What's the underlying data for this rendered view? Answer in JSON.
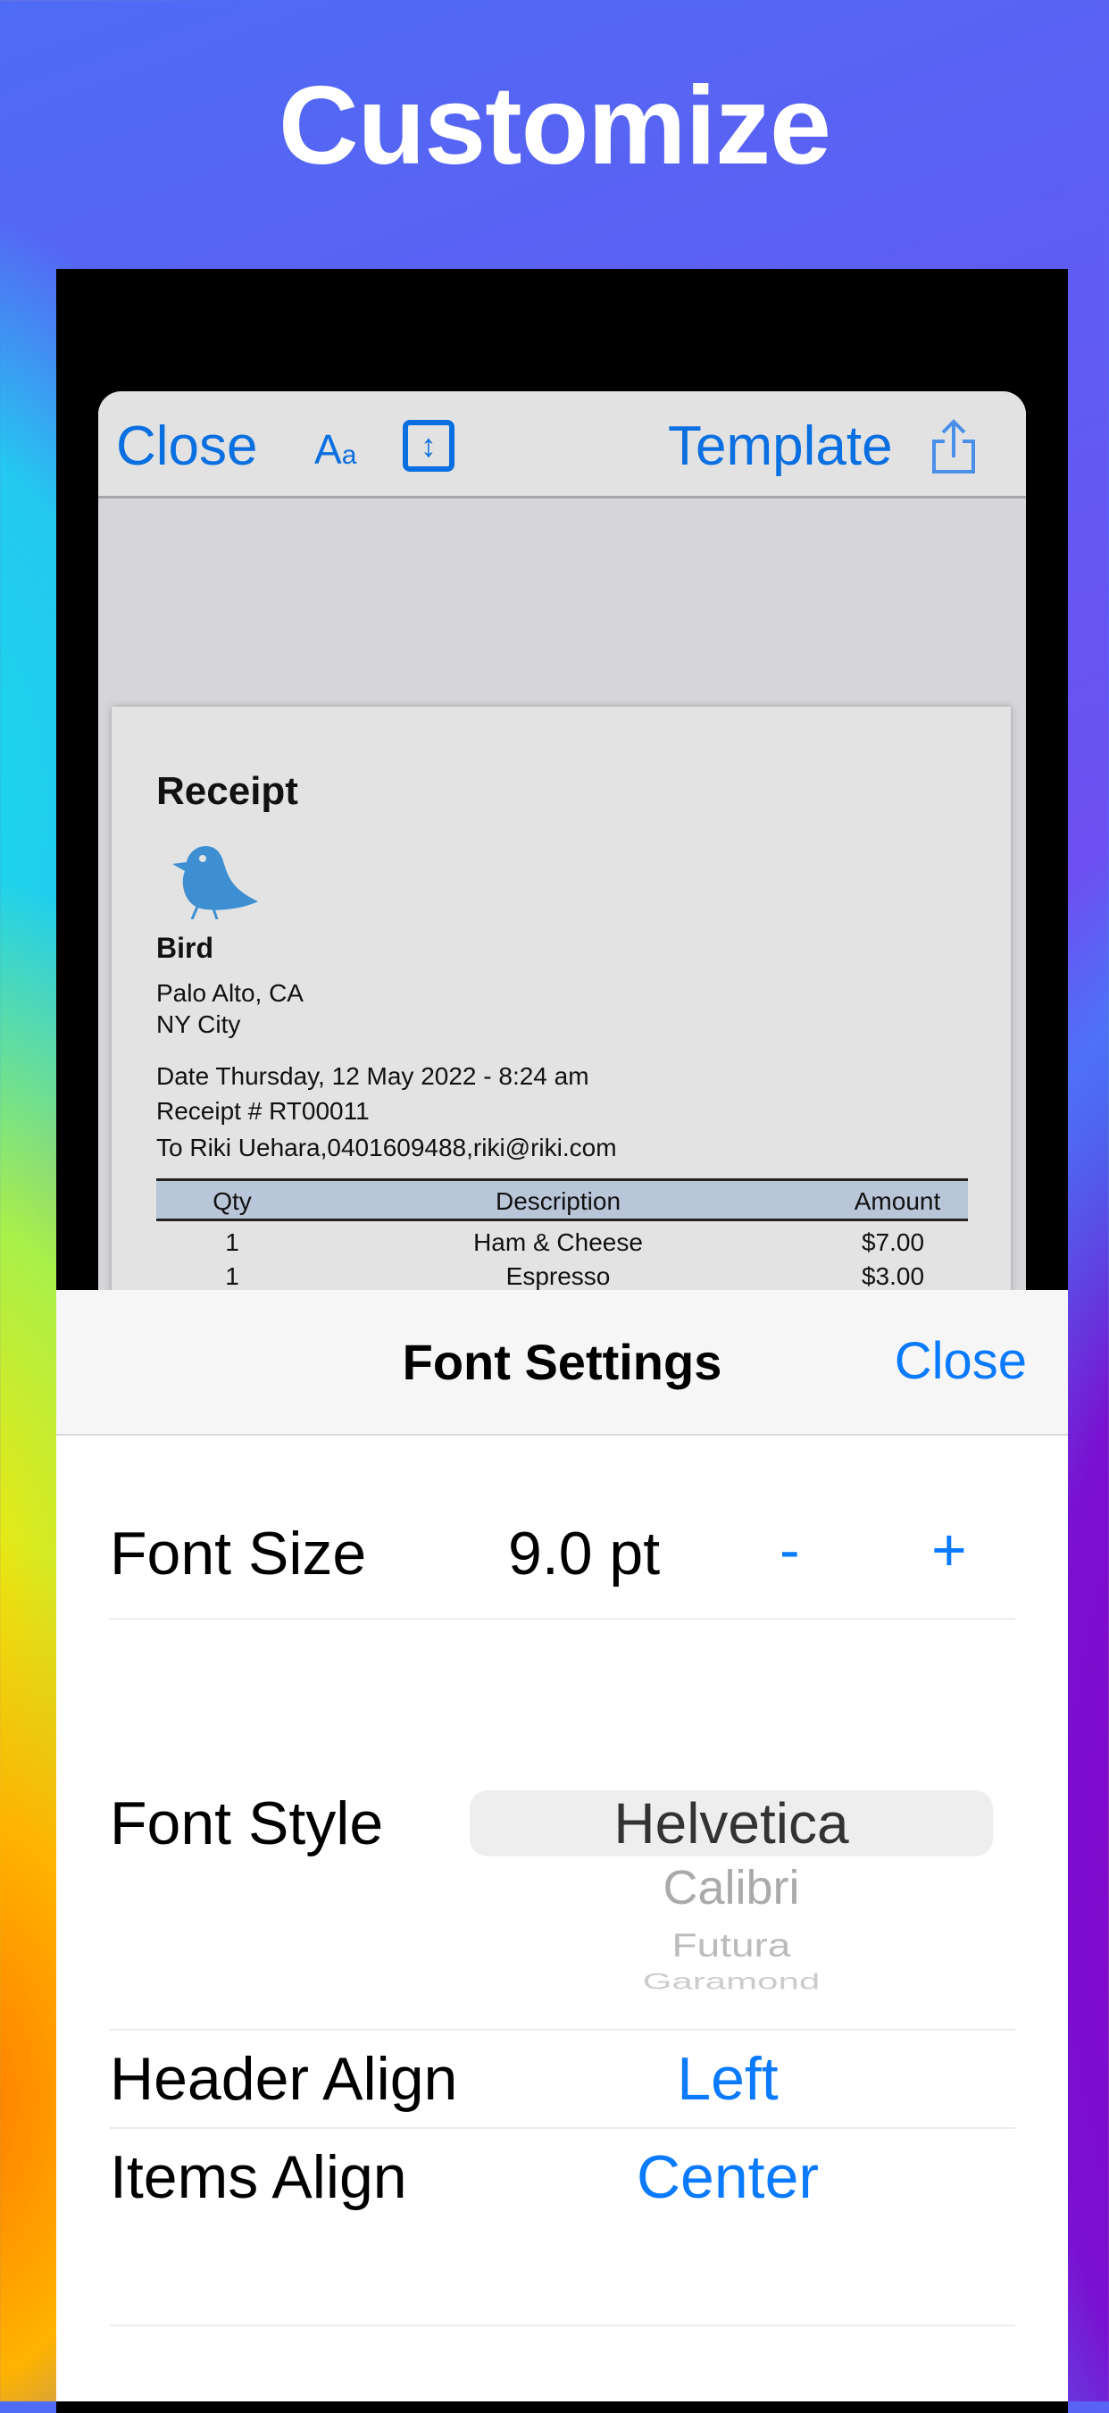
{
  "hero_title": "Customize",
  "toolbar": {
    "close": "Close",
    "template": "Template"
  },
  "receipt": {
    "title": "Receipt",
    "business": "Bird",
    "address1": "Palo Alto, CA",
    "address2": "NY City",
    "date": "Date  Thursday, 12 May 2022 - 8:24 am",
    "number": "Receipt #  RT00011",
    "to": "To Riki Uehara,0401609488,riki@riki.com",
    "columns": [
      "Qty",
      "Description",
      "Amount"
    ],
    "rows": [
      {
        "qty": "1",
        "desc": "Ham & Cheese",
        "amount": "$7.00"
      },
      {
        "qty": "1",
        "desc": "Espresso",
        "amount": "$3.00"
      }
    ]
  },
  "font_settings": {
    "title": "Font Settings",
    "close": "Close",
    "font_size_label": "Font Size",
    "font_size_value": "9.0 pt",
    "decrement": "-",
    "increment": "+",
    "font_style_label": "Font Style",
    "font_options": [
      "Helvetica",
      "Calibri",
      "Futura",
      "Garamond"
    ],
    "header_align_label": "Header Align",
    "header_align_value": "Left",
    "items_align_label": "Items Align",
    "items_align_value": "Center"
  },
  "colors": {
    "accent": "#0a7aff",
    "table_header": "#b9c6d8",
    "bird": "#3d8fd1"
  }
}
